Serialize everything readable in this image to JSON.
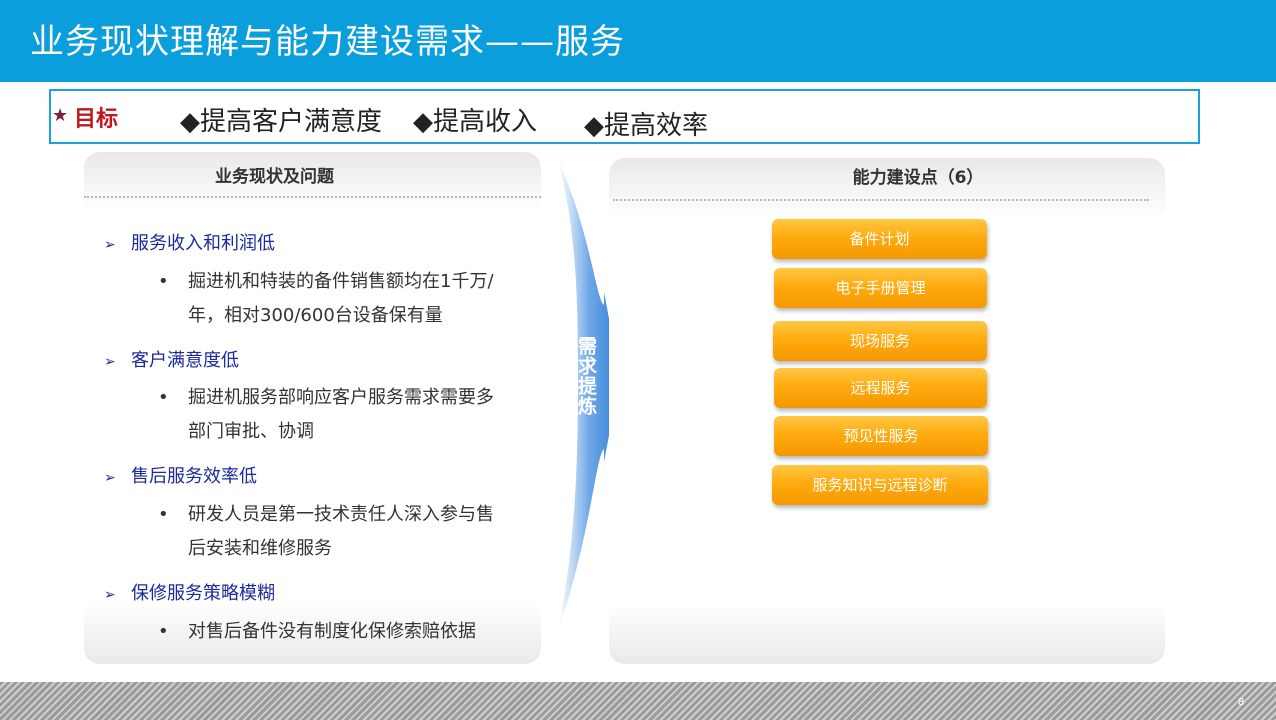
{
  "header": {
    "title": "业务现状理解与能力建设需求——服务"
  },
  "goals": {
    "label": "目标",
    "items": [
      "◆提高客户满意度",
      "◆提高收入",
      "◆提高效率"
    ]
  },
  "left_panel": {
    "title": "业务现状及问题",
    "issues": [
      {
        "title": "服务收入和利润低",
        "detail_lines": [
          "掘进机和特装的备件销售额均在1千万/",
          "年，相对300/600台设备保有量"
        ]
      },
      {
        "title": "客户满意度低",
        "detail_lines": [
          "掘进机服务部响应客户服务需求需要多",
          "部门审批、协调"
        ]
      },
      {
        "title": "售后服务效率低",
        "detail_lines": [
          "研发人员是第一技术责任人深入参与售",
          "后安装和维修服务"
        ]
      },
      {
        "title": "保修服务策略模糊",
        "detail_lines": [
          "对售后备件没有制度化保修索赔依据"
        ]
      }
    ]
  },
  "arrow": {
    "label": "需求提炼"
  },
  "right_panel": {
    "title": "能力建设点（6）",
    "items": [
      "备件计划",
      "电子手册管理",
      "现场服务",
      "远程服务",
      "预见性服务",
      "服务知识与远程诊断"
    ]
  },
  "footer": {
    "page_number": "8"
  },
  "colors": {
    "header_bg": "#0a9fdc",
    "goal_border": "#1aa3d6",
    "goal_label": "#c0181f",
    "issue_text": "#1a2a9c",
    "button_orange": "#ffab10",
    "arrow_blue": "#2f7fd4"
  }
}
